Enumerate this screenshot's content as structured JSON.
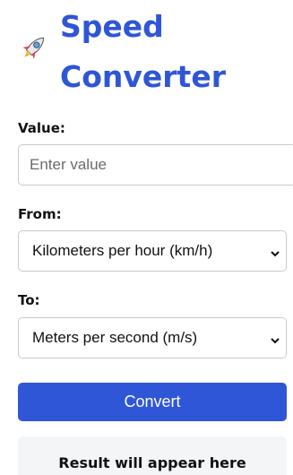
{
  "header": {
    "icon": "rocket-icon",
    "title": "Speed Converter"
  },
  "form": {
    "value_label": "Value:",
    "value_input": {
      "value": "",
      "placeholder": "Enter value"
    },
    "from_label": "From:",
    "from_select": {
      "selected": "Kilometers per hour (km/h)"
    },
    "to_label": "To:",
    "to_select": {
      "selected": "Meters per second (m/s)"
    },
    "convert_label": "Convert"
  },
  "result": {
    "text": "Result will appear here"
  },
  "colors": {
    "accent": "#2f56d6",
    "result_bg": "#f4f5f7"
  }
}
